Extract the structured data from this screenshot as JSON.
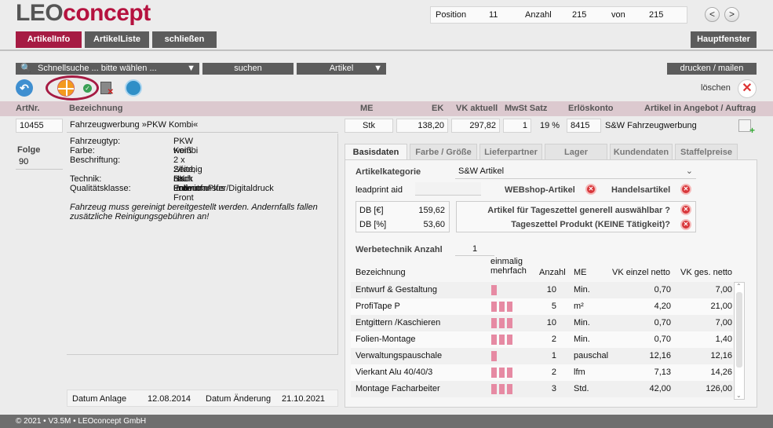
{
  "app": {
    "logo_part1": "LEO",
    "logo_part2": "concept"
  },
  "position": {
    "position_label": "Position",
    "position_value": "11",
    "count_label": "Anzahl",
    "count_value": "215",
    "of_label": "von",
    "of_value": "215",
    "prev": "<",
    "next": ">"
  },
  "tabs_top": {
    "artikelinfo": "ArtikelInfo",
    "artikelliste": "ArtikelListe",
    "schliessen": "schließen",
    "hauptfenster": "Hauptfenster"
  },
  "search": {
    "quick": "Schnellsuche ... bitte wählen ...",
    "suchen": "suchen",
    "artikel": "Artikel",
    "drucken": "drucken / mailen",
    "loeschen": "löschen"
  },
  "header": {
    "artnr": "ArtNr.",
    "bezeichnung": "Bezeichnung",
    "me": "ME",
    "ek": "EK",
    "vk": "VK aktuell",
    "mwst": "MwSt Satz",
    "erloes": "Erlöskonto",
    "angebot": "Artikel in Angebot / Auftrag"
  },
  "article": {
    "artnr": "10455",
    "bezeichnung": "Fahrzeugwerbung »PKW Kombi«",
    "me": "Stk",
    "ek": "138,20",
    "vk": "297,82",
    "mwst_value": "1",
    "mwst_pct": "19 %",
    "konto": "8415",
    "konto_name": "S&W Fahrzeugwerbung",
    "folge_label": "Folge",
    "folge": "90",
    "specs": [
      {
        "k": "Fahrzeugtyp:",
        "v": "PKW Kombi"
      },
      {
        "k": "Farbe:",
        "v": "weiß"
      },
      {
        "k": "Beschriftung:",
        "v": "2 x Seite, Heck und Front"
      },
      {
        "k": "",
        "v": "2/farbig nach Entwurf"
      },
      {
        "k": "Technik:",
        "v": "SK-Folientransfer/Digitaldruck"
      },
      {
        "k": "Qualitätsklasse:",
        "v": "PremiumPlus"
      }
    ],
    "note": "Fahrzeug muss gereinigt bereitgestellt werden. Andernfalls fallen zusätzliche Reinigungsgebühren an!",
    "datum_anlage_label": "Datum Anlage",
    "datum_anlage": "12.08.2014",
    "datum_aend_label": "Datum Änderung",
    "datum_aend": "21.10.2021"
  },
  "detail_tabs": [
    "Basisdaten",
    "Farbe / Größe",
    "Lieferpartner",
    "Lager",
    "Kundendaten",
    "Staffelpreise"
  ],
  "basis": {
    "kategorie_label": "Artikelkategorie",
    "kategorie": "S&W Artikel",
    "leadprint_label": "leadprint aid",
    "webshop_label": "WEBshop-Artikel",
    "handels_label": "Handelsartikel",
    "db_eur_label": "DB [€]",
    "db_eur": "159,62",
    "db_pct_label": "DB [%]",
    "db_pct": "53,60",
    "tages1": "Artikel für Tageszettel generell auswählbar ?",
    "tages2": "Tageszettel Produkt (KEINE Tätigkeit)?",
    "werbe_label": "Werbetechnik Anzahl",
    "werbe_value": "1"
  },
  "werbe_table": {
    "headers": {
      "bez": "Bezeichnung",
      "freq1": "einmalig",
      "freq2": "mehrfach",
      "anzahl": "Anzahl",
      "me": "ME",
      "vke": "VK einzel netto",
      "vkg": "VK ges. netto"
    },
    "rows": [
      {
        "bez": "Entwurf & Gestaltung",
        "bars": 1,
        "anzahl": "10",
        "me": "Min.",
        "vke": "0,70",
        "vkg": "7,00"
      },
      {
        "bez": "ProfiTape P",
        "bars": 3,
        "anzahl": "5",
        "me": "m²",
        "vke": "4,20",
        "vkg": "21,00"
      },
      {
        "bez": "Entgittern /Kaschieren",
        "bars": 3,
        "anzahl": "10",
        "me": "Min.",
        "vke": "0,70",
        "vkg": "7,00"
      },
      {
        "bez": "Folien-Montage",
        "bars": 3,
        "anzahl": "2",
        "me": "Min.",
        "vke": "0,70",
        "vkg": "1,40"
      },
      {
        "bez": "Verwaltungspauschale",
        "bars": 1,
        "anzahl": "1",
        "me": "pauschal",
        "vke": "12,16",
        "vkg": "12,16"
      },
      {
        "bez": "Vierkant Alu 40/40/3",
        "bars": 3,
        "anzahl": "2",
        "me": "lfm",
        "vke": "7,13",
        "vkg": "14,26"
      },
      {
        "bez": "Montage Facharbeiter",
        "bars": 3,
        "anzahl": "3",
        "me": "Std.",
        "vke": "42,00",
        "vkg": "126,00"
      }
    ]
  },
  "footer": {
    "text": "© 2021 • V3.5M • LEOconcept GmbH"
  },
  "colors": {
    "accent": "#a61b43",
    "header_band": "#dcc9cf",
    "bar": "#e68aa3"
  }
}
